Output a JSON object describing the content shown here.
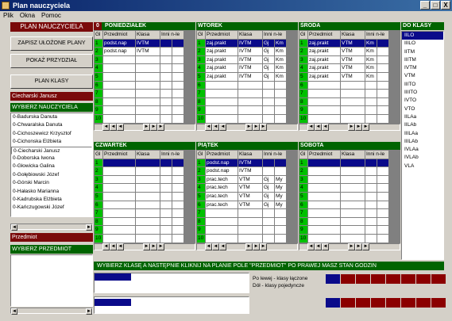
{
  "window": {
    "title": "Plan nauczyciela",
    "min": "_",
    "max": "□",
    "close": "X"
  },
  "menu": [
    "Plik",
    "Okna",
    "Pomoc"
  ],
  "left": {
    "title": "PLAN NAUCZYCIELA",
    "buttons": [
      "ZAPISZ UŁOŻONE PLANY",
      "POKAŻ PRZYDZIAŁ",
      "PLAN KLASY"
    ],
    "current_teacher": "Ciecharski Janusz",
    "select_teacher_label": "WYBIERZ NAUCZYCIELA",
    "teachers": [
      "0-Badurska Danuta",
      "0-Chwaralska Danuta",
      "0-Cichoszewicz Krzysztof",
      "0-Cichonska Elżbieta",
      "0-Ciecharski Janusz",
      "0-Doborska Iwona",
      "0-Głowicka Galina",
      "0-Gołębiowski Józef",
      "0-Górski Marcin",
      "0-Hałasko Marianna",
      "0-Kadrubska Elżbieta",
      "0-Kańczugowski Józef"
    ],
    "subject_label": "Przedmiot",
    "select_subject_label": "WYBIERZ PRZEDMIOT"
  },
  "columns": [
    "Gl",
    "Przedmiot",
    "Klasa",
    "Inni n-le"
  ],
  "days": [
    {
      "name": "PONIEDZIAŁEK",
      "num": "0",
      "rows": [
        [
          "1",
          "podst.nap",
          "IVTM",
          "",
          ""
        ],
        [
          "2",
          "podst.nap",
          "IVTM",
          "",
          ""
        ],
        [
          "3",
          "",
          "",
          "",
          ""
        ],
        [
          "4",
          "",
          "",
          "",
          ""
        ],
        [
          "5",
          "",
          "",
          "",
          ""
        ],
        [
          "6",
          "",
          "",
          "",
          ""
        ],
        [
          "7",
          "",
          "",
          "",
          ""
        ],
        [
          "8",
          "",
          "",
          "",
          ""
        ],
        [
          "9",
          "",
          "",
          "",
          ""
        ],
        [
          "10",
          "",
          "",
          "",
          ""
        ]
      ]
    },
    {
      "name": "WTOREK",
      "rows": [
        [
          "1",
          "zaj.prakt",
          "IVTM",
          "Gj",
          "Km"
        ],
        [
          "2",
          "zaj.prakt",
          "IVTM",
          "Gj",
          "Km"
        ],
        [
          "3",
          "zaj.prakt",
          "IVTM",
          "Gj",
          "Km"
        ],
        [
          "4",
          "zaj.prakt",
          "IVTM",
          "Gj",
          "Km"
        ],
        [
          "5",
          "zaj.prakt",
          "IVTM",
          "Gj",
          "Km"
        ],
        [
          "6",
          "",
          "",
          "",
          ""
        ],
        [
          "7",
          "",
          "",
          "",
          ""
        ],
        [
          "8",
          "",
          "",
          "",
          ""
        ],
        [
          "9",
          "",
          "",
          "",
          ""
        ],
        [
          "10",
          "",
          "",
          "",
          ""
        ]
      ]
    },
    {
      "name": "ŚRODA",
      "rows": [
        [
          "1",
          "zaj.prakt",
          "VTM",
          "Km",
          ""
        ],
        [
          "2",
          "zaj.prakt",
          "VTM",
          "Km",
          ""
        ],
        [
          "3",
          "zaj.prakt",
          "VTM",
          "Km",
          ""
        ],
        [
          "4",
          "zaj.prakt",
          "VTM",
          "Km",
          ""
        ],
        [
          "5",
          "zaj.prakt",
          "VTM",
          "Km",
          ""
        ],
        [
          "6",
          "",
          "",
          "",
          ""
        ],
        [
          "7",
          "",
          "",
          "",
          ""
        ],
        [
          "8",
          "",
          "",
          "",
          ""
        ],
        [
          "9",
          "",
          "",
          "",
          ""
        ],
        [
          "10",
          "",
          "",
          "",
          ""
        ]
      ]
    },
    {
      "name": "CZWARTEK",
      "rows": [
        [
          "1",
          "",
          "",
          "",
          ""
        ],
        [
          "2",
          "",
          "",
          "",
          ""
        ],
        [
          "3",
          "",
          "",
          "",
          ""
        ],
        [
          "4",
          "",
          "",
          "",
          ""
        ],
        [
          "5",
          "",
          "",
          "",
          ""
        ],
        [
          "6",
          "",
          "",
          "",
          ""
        ],
        [
          "7",
          "",
          "",
          "",
          ""
        ],
        [
          "8",
          "",
          "",
          "",
          ""
        ],
        [
          "9",
          "",
          "",
          "",
          ""
        ],
        [
          "10",
          "",
          "",
          "",
          ""
        ]
      ]
    },
    {
      "name": "PIĄTEK",
      "rows": [
        [
          "1",
          "podst.nap",
          "IVTM",
          "",
          ""
        ],
        [
          "2",
          "podst.nap",
          "IVTM",
          "",
          ""
        ],
        [
          "3",
          "prac.tech",
          "VTM",
          "Gj",
          "My"
        ],
        [
          "4",
          "prac.tech",
          "VTM",
          "Gj",
          "My"
        ],
        [
          "5",
          "prac.tech",
          "VTM",
          "Gj",
          "My"
        ],
        [
          "6",
          "prac.tech",
          "VTM",
          "Gj",
          "My"
        ],
        [
          "7",
          "",
          "",
          "",
          ""
        ],
        [
          "8",
          "",
          "",
          "",
          ""
        ],
        [
          "9",
          "",
          "",
          "",
          ""
        ],
        [
          "10",
          "",
          "",
          "",
          ""
        ]
      ]
    },
    {
      "name": "SOBOTA",
      "rows": [
        [
          "1",
          "",
          "",
          "",
          ""
        ],
        [
          "2",
          "",
          "",
          "",
          ""
        ],
        [
          "3",
          "",
          "",
          "",
          ""
        ],
        [
          "4",
          "",
          "",
          "",
          ""
        ],
        [
          "5",
          "",
          "",
          "",
          ""
        ],
        [
          "6",
          "",
          "",
          "",
          ""
        ],
        [
          "7",
          "",
          "",
          "",
          ""
        ],
        [
          "8",
          "",
          "",
          "",
          ""
        ],
        [
          "9",
          "",
          "",
          "",
          ""
        ],
        [
          "10",
          "",
          "",
          "",
          ""
        ]
      ]
    }
  ],
  "classes": {
    "title": "DO KLASY",
    "items": [
      "IILO",
      "IIILO",
      "IITM",
      "IIITM",
      "IVTM",
      "VTM",
      "IIITO",
      "IIIITO",
      "IVTO",
      "VTO",
      "IILAa",
      "IILAb",
      "IIILAa",
      "IIILAb",
      "IVLAa",
      "IVLAb",
      "VLA"
    ]
  },
  "bottom": {
    "instruction": "WYBIERZ KLASĘ A NASTĘPNIE  KLIKNIJ NA PLANIE POLE  \"PRZEDMIOT\"  PO PRAWEJ MASZ STAN GODZIN",
    "legend_line1": "Po lewej - klasy łączone",
    "legend_line2": "Dół - klasy pojedyncze"
  },
  "nav_glyphs": [
    "◄",
    "◄",
    "◄",
    "►",
    "►",
    "►"
  ],
  "colors": {
    "dark_red": "#7a0a0a",
    "green": "#006400",
    "bright_green": "#00c000",
    "navy": "#0a0a8a"
  }
}
